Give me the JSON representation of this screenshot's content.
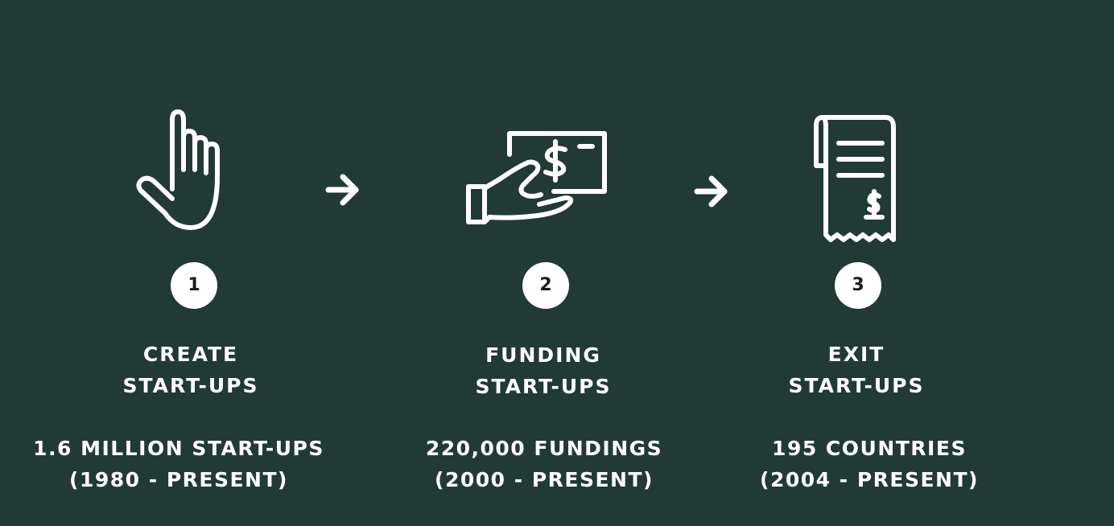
{
  "steps": [
    {
      "number": "1",
      "icon": "pointing-hand-icon",
      "title_line1": "CREATE",
      "title_line2": "START-UPS",
      "stat_line1": "1.6 MILLION START-UPS",
      "stat_line2": "(1980 - PRESENT)"
    },
    {
      "number": "2",
      "icon": "hand-holding-money-icon",
      "title_line1": "FUNDING",
      "title_line2": "START-UPS",
      "stat_line1": "220,000 FUNDINGS",
      "stat_line2": "(2000 - PRESENT)"
    },
    {
      "number": "3",
      "icon": "receipt-icon",
      "title_line1": "EXIT",
      "title_line2": "START-UPS",
      "stat_line1": "195 COUNTRIES",
      "stat_line2": "(2004 - PRESENT)"
    }
  ],
  "colors": {
    "background": "#223a35",
    "foreground": "#ffffff",
    "badge_text": "#1c1c1c"
  }
}
